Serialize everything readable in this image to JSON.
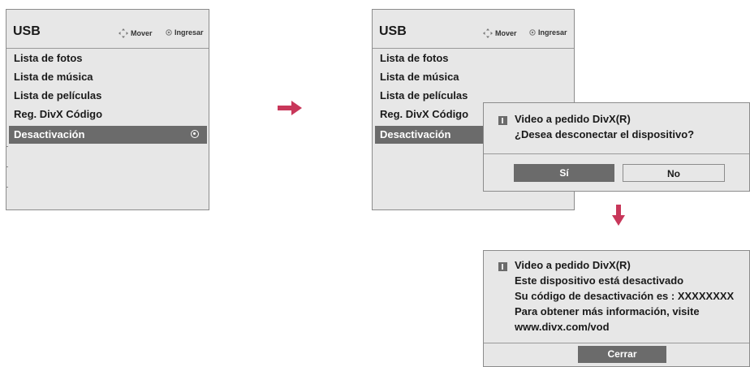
{
  "screen1": {
    "title": "USB",
    "hint_move": "Mover",
    "hint_enter": "Ingresar",
    "menu": [
      "Lista de fotos",
      "Lista de música",
      "Lista de películas",
      "Reg. DivX Código",
      "Desactivación"
    ]
  },
  "screen2": {
    "title": "USB",
    "hint_move": "Mover",
    "hint_enter": "Ingresar",
    "menu": [
      "Lista de fotos",
      "Lista de música",
      "Lista de películas",
      "Reg. DivX Código",
      "Desactivación"
    ]
  },
  "confirm_dialog": {
    "title": "Video a pedido DivX(R)",
    "question": "¿Desea desconectar el dispositivo?",
    "yes_label": "Sí",
    "no_label": "No"
  },
  "result_dialog": {
    "lines": [
      "Video a pedido DivX(R)",
      "Este dispositivo está desactivado",
      "Su código de desactivación es : XXXXXXXX",
      "Para obtener más información, visite",
      "www.divx.com/vod"
    ],
    "close_label": "Cerrar"
  },
  "colors": {
    "panel_bg": "#e7e7e7",
    "highlight": "#6b6b6b",
    "arrow": "#c8375a"
  },
  "icons": {
    "move": "four-way-arrows-icon",
    "enter": "ok-circle-icon",
    "flow_right": "arrow-right-icon",
    "flow_down": "arrow-down-icon",
    "info": "info-marker-icon",
    "selected": "radio-selected-icon"
  }
}
